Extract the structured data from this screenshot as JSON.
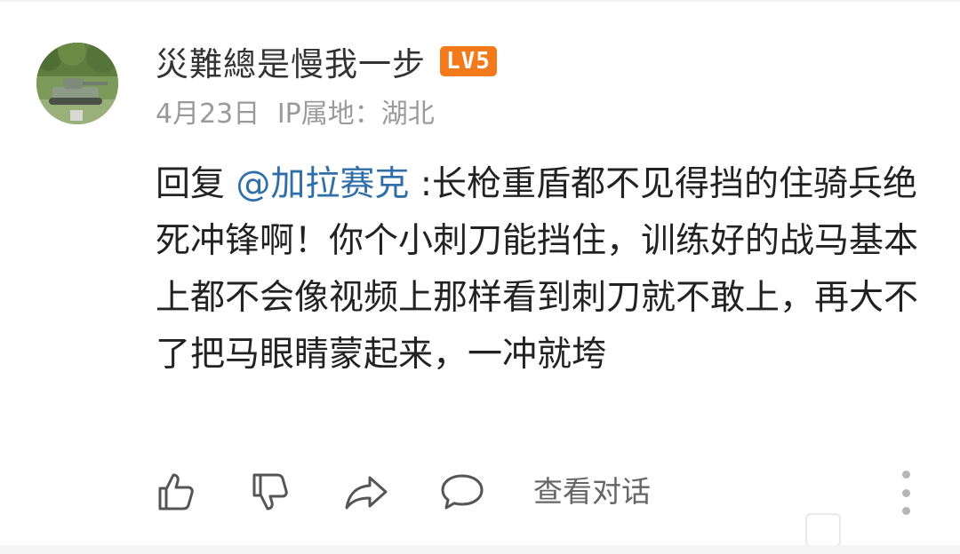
{
  "post": {
    "username": "災難總是慢我一步",
    "level_badge": "LV5",
    "date": "4月23日",
    "ip_location": "IP属地：湖北",
    "reply_prefix": "回复",
    "mention": "@加拉赛克",
    "comment_text": ":长枪重盾都不见得挡的住骑兵绝死冲锋啊！你个小刺刀能挡住，训练好的战马基本上都不会像视频上那样看到刺刀就不敢上，再大不了把马眼睛蒙起来，一冲就垮"
  },
  "actions": {
    "like_icon": "thumbs-up-icon",
    "dislike_icon": "thumbs-down-icon",
    "share_icon": "share-arrow-icon",
    "comment_icon": "comment-bubble-icon",
    "view_dialog_label": "查看对话",
    "more_icon": "more-vertical-icon"
  },
  "colors": {
    "mention": "#2f6ea6",
    "badge": "#f27a1a",
    "meta_text": "#9a9a9a",
    "body_text": "#222222"
  }
}
